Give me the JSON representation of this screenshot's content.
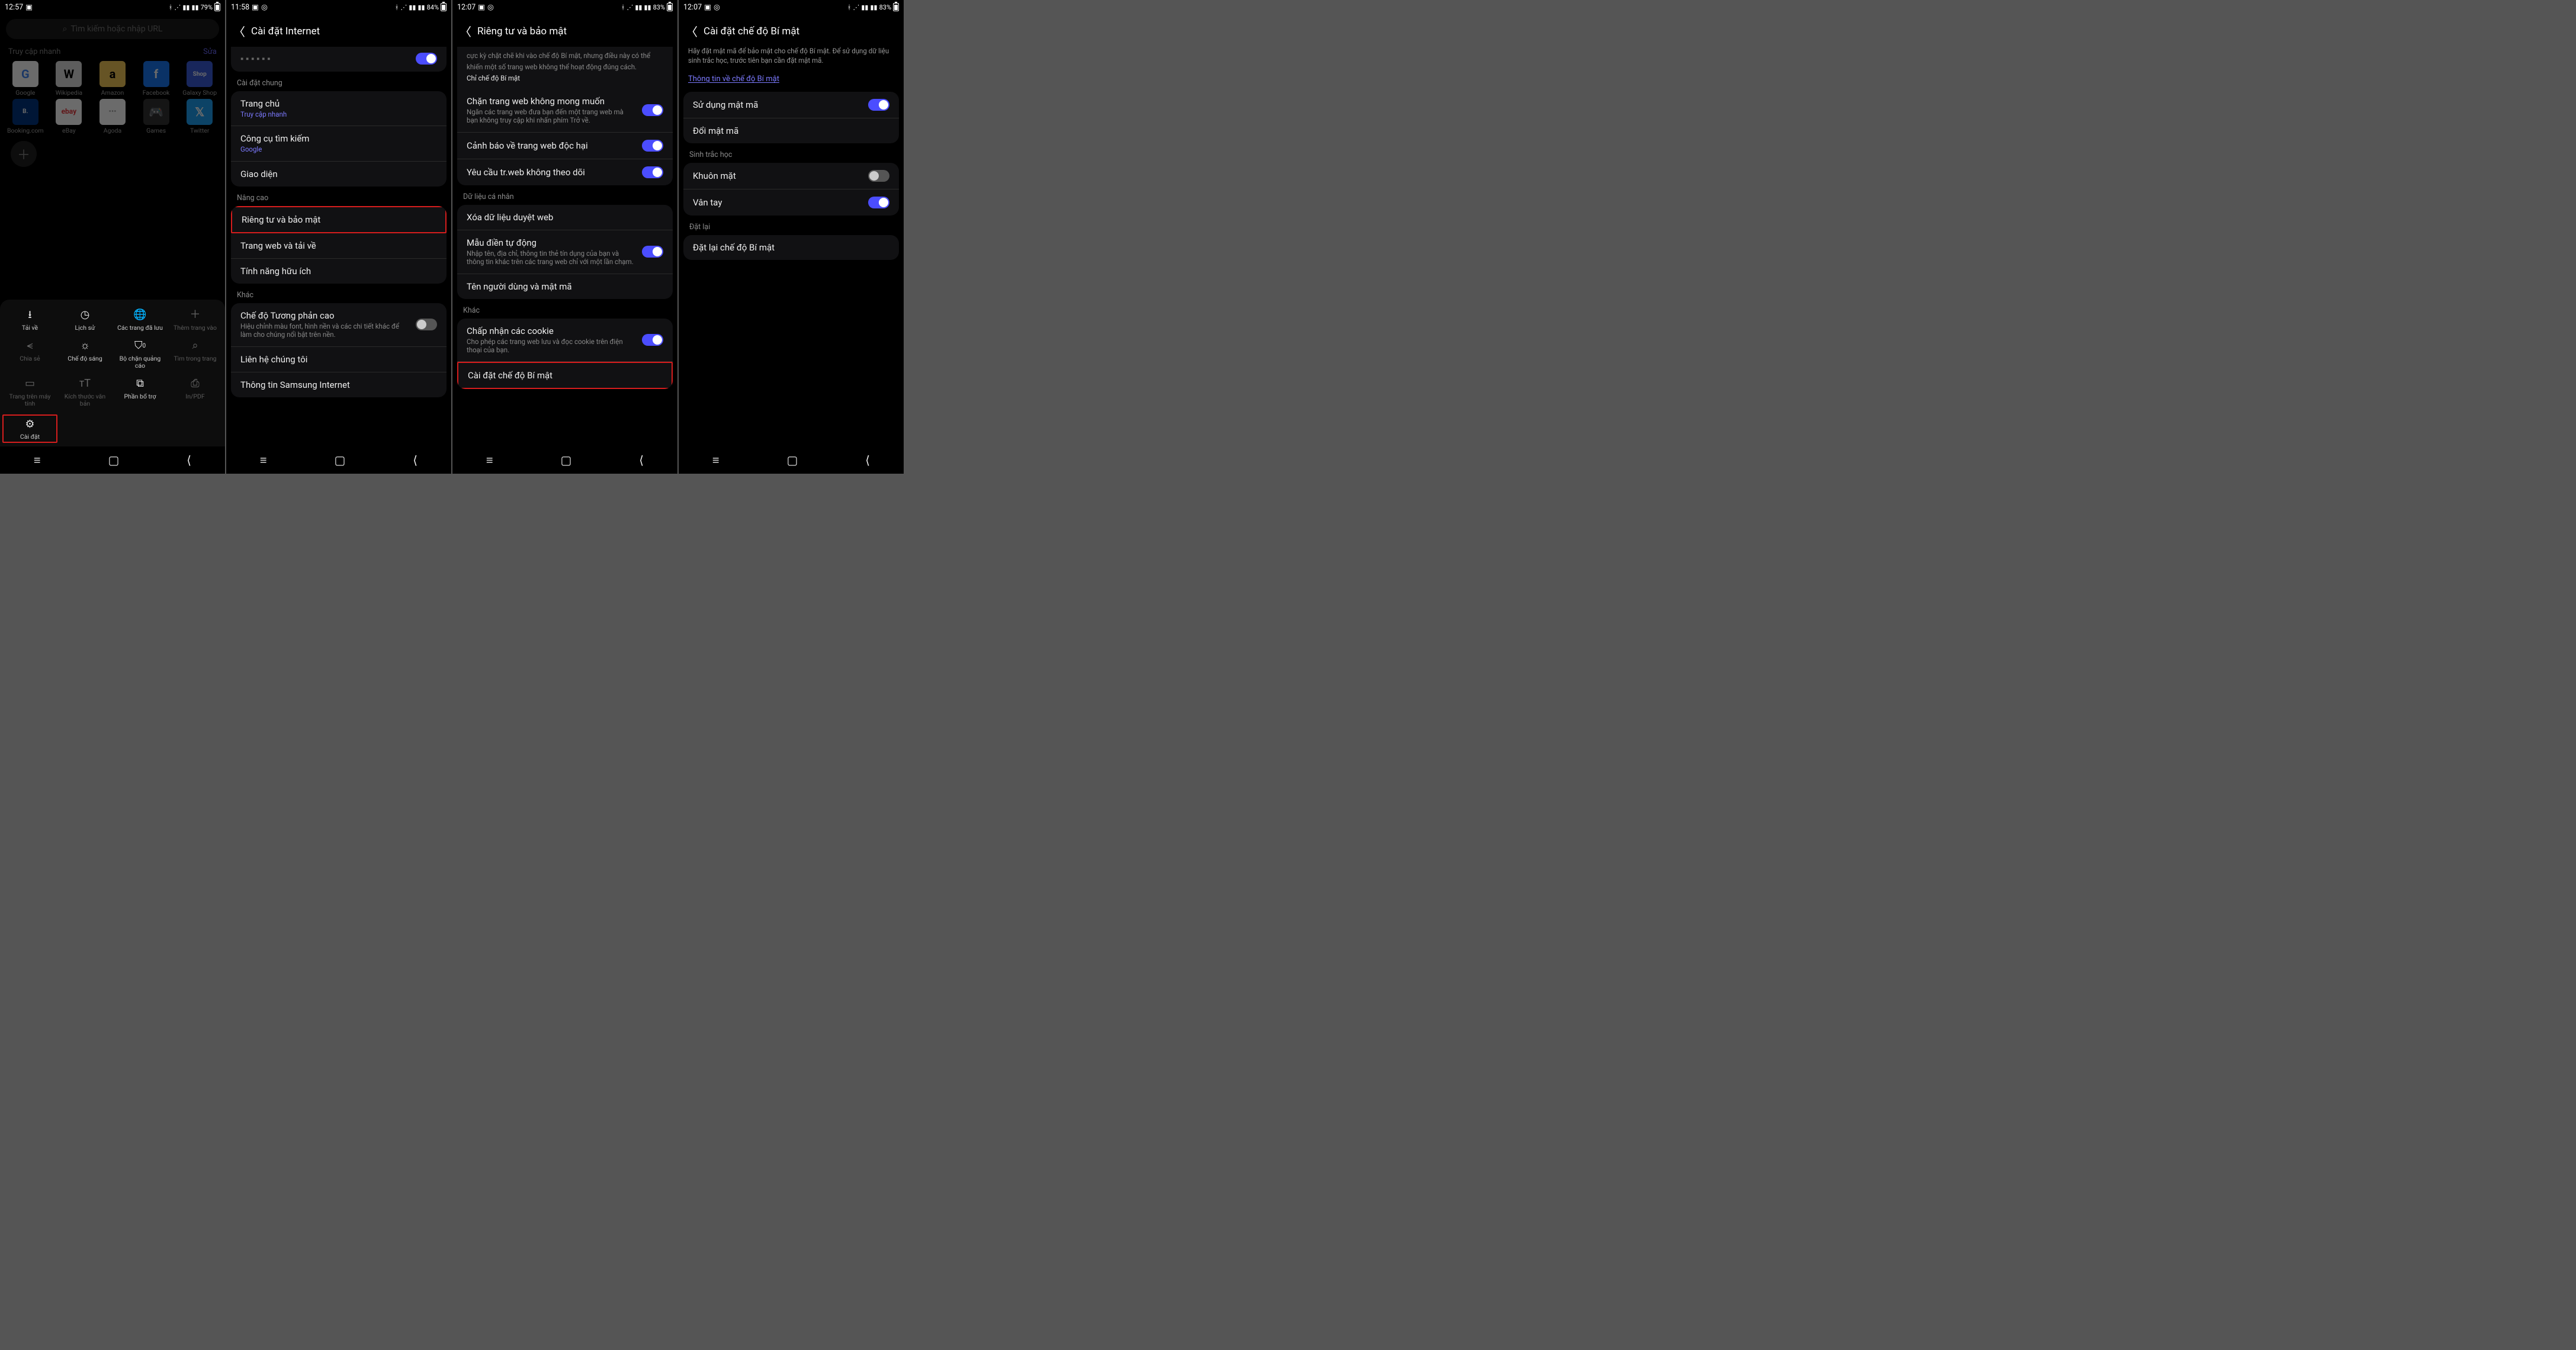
{
  "s1": {
    "status": {
      "time": "12:57",
      "battery": "79%"
    },
    "searchPlaceholder": "Tìm kiếm hoặc nhập URL",
    "quickTitle": "Truy cập nhanh",
    "edit": "Sửa",
    "sites": [
      "Google",
      "Wikipedia",
      "Amazon",
      "Facebook",
      "Galaxy Shop",
      "Booking.com",
      "eBay",
      "Agoda",
      "Games",
      "Twitter"
    ],
    "tools": [
      "Tải về",
      "Lịch sử",
      "Các trang đã lưu",
      "Thêm trang vào",
      "Chia sẻ",
      "Chế độ sáng",
      "Bộ chặn quảng cáo",
      "Tìm trong trang",
      "Trang trên máy tính",
      "Kích thước văn bản",
      "Phần bổ trợ",
      "In/PDF",
      "Cài đặt"
    ],
    "toolsBlocked": "0"
  },
  "s2": {
    "status": {
      "time": "11:58",
      "battery": "84%"
    },
    "header": "Cài đặt Internet",
    "group1": "Cài đặt chung",
    "home": {
      "t": "Trang chủ",
      "s": "Truy cập nhanh"
    },
    "search": {
      "t": "Công cụ tìm kiếm",
      "s": "Google"
    },
    "ui": "Giao diện",
    "group2": "Nâng cao",
    "privacy": "Riêng tư và bảo mật",
    "webdl": "Trang web và tải về",
    "useful": "Tính năng hữu ích",
    "group3": "Khác",
    "contrast": {
      "t": "Chế độ Tương phản cao",
      "s": "Hiệu chỉnh màu font, hình nền và các chi tiết khác để làm cho chúng nổi bật trên nền."
    },
    "contact": "Liên hệ chúng tôi",
    "about": "Thông tin Samsung Internet"
  },
  "s3": {
    "status": {
      "time": "12:07",
      "battery": "83%"
    },
    "header": "Riêng tư và bảo mật",
    "introSub": "cực kỳ chặt chẽ khi vào chế độ Bí mật, nhưng điều này có thể khiến một số trang web không thể hoạt động đúng cách.",
    "introLink": "Chỉ chế độ Bí mật",
    "block": {
      "t": "Chặn trang web không mong muốn",
      "s": "Ngăn các trang web đưa bạn đến một trang web mà bạn không truy cập khi nhấn phím Trở về."
    },
    "warn": "Cảnh báo về trang web độc hại",
    "dnt": "Yêu cầu tr.web không theo dõi",
    "gPersonal": "Dữ liệu cá nhân",
    "clear": "Xóa dữ liệu duyệt web",
    "autofill": {
      "t": "Mẫu điền tự động",
      "s": "Nhập tên, địa chỉ, thông tin thẻ tín dụng của bạn và thông tin khác trên các trang web chỉ với một lần chạm."
    },
    "userpass": "Tên người dùng và mật mã",
    "gOther": "Khác",
    "cookie": {
      "t": "Chấp nhận các cookie",
      "s": "Cho phép các trang web lưu và đọc cookie trên điện thoại của bạn."
    },
    "secret": "Cài đặt chế độ Bí mật"
  },
  "s4": {
    "status": {
      "time": "12:07",
      "battery": "83%"
    },
    "header": "Cài đặt chế độ Bí mật",
    "intro": "Hãy đặt mật mã để bảo mật cho chế độ Bí mật. Để sử dụng dữ liệu sinh trắc học, trước tiên bạn cần đặt mật mã.",
    "link": "Thông tin về chế độ Bí mật",
    "usePass": "Sử dụng mật mã",
    "changePass": "Đổi mật mã",
    "gBio": "Sinh trắc học",
    "face": "Khuôn mặt",
    "finger": "Vân tay",
    "gReset": "Đặt lại",
    "reset": "Đặt lại chế độ Bí mật"
  }
}
